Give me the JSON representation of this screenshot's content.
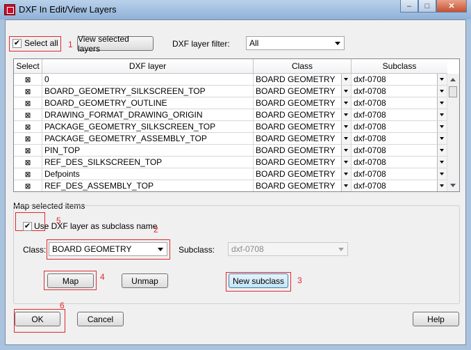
{
  "window": {
    "title": "DXF In Edit/View Layers"
  },
  "toolbar": {
    "select_all_label": "Select all",
    "select_all_checked": true,
    "view_selected_label": "View selected layers",
    "filter_label": "DXF layer filter:",
    "filter_value": "All"
  },
  "grid": {
    "columns": [
      "Select",
      "DXF layer",
      "Class",
      "Subclass"
    ],
    "rows": [
      {
        "layer": "0",
        "class": "BOARD GEOMETRY",
        "subclass": "dxf-0708"
      },
      {
        "layer": "BOARD_GEOMETRY_SILKSCREEN_TOP",
        "class": "BOARD GEOMETRY",
        "subclass": "dxf-0708"
      },
      {
        "layer": "BOARD_GEOMETRY_OUTLINE",
        "class": "BOARD GEOMETRY",
        "subclass": "dxf-0708"
      },
      {
        "layer": "DRAWING_FORMAT_DRAWING_ORIGIN",
        "class": "BOARD GEOMETRY",
        "subclass": "dxf-0708"
      },
      {
        "layer": "PACKAGE_GEOMETRY_SILKSCREEN_TOP",
        "class": "BOARD GEOMETRY",
        "subclass": "dxf-0708"
      },
      {
        "layer": "PACKAGE_GEOMETRY_ASSEMBLY_TOP",
        "class": "BOARD GEOMETRY",
        "subclass": "dxf-0708"
      },
      {
        "layer": "PIN_TOP",
        "class": "BOARD GEOMETRY",
        "subclass": "dxf-0708"
      },
      {
        "layer": "REF_DES_SILKSCREEN_TOP",
        "class": "BOARD GEOMETRY",
        "subclass": "dxf-0708"
      },
      {
        "layer": "Defpoints",
        "class": "BOARD GEOMETRY",
        "subclass": "dxf-0708"
      },
      {
        "layer": "REF_DES_ASSEMBLY_TOP",
        "class": "BOARD GEOMETRY",
        "subclass": "dxf-0708"
      }
    ]
  },
  "map": {
    "group_label": "Map selected items",
    "use_dxf_label": "Use DXF layer as subclass name",
    "use_dxf_checked": true,
    "class_label": "Class:",
    "class_value": "BOARD GEOMETRY",
    "subclass_label": "Subclass:",
    "subclass_value": "dxf-0708",
    "map_button": "Map",
    "unmap_button": "Unmap",
    "new_subclass_button": "New subclass"
  },
  "footer": {
    "ok": "OK",
    "cancel": "Cancel",
    "help": "Help"
  },
  "annotations": {
    "n1": "1",
    "n2": "2",
    "n3": "3",
    "n4": "4",
    "n5": "5",
    "n6": "6"
  },
  "colors": {
    "annotation_red": "#e0282e",
    "title_bar": "#a9c3df"
  }
}
